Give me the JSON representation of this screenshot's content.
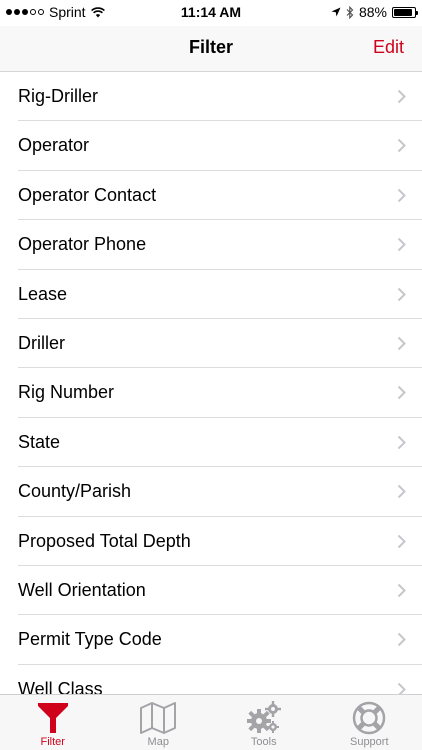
{
  "status_bar": {
    "carrier": "Sprint",
    "time": "11:14 AM",
    "battery": "88%",
    "battery_level": 0.88,
    "icons": [
      "signal-dots",
      "wifi-icon",
      "location-arrow-icon",
      "bluetooth-icon",
      "battery-icon"
    ]
  },
  "nav": {
    "title": "Filter",
    "edit_label": "Edit"
  },
  "colors": {
    "accent": "#d0021b",
    "inactive": "#8e8e93",
    "separator": "#dcdcdf"
  },
  "list": {
    "items": [
      {
        "label": "Rig-Driller"
      },
      {
        "label": "Operator"
      },
      {
        "label": "Operator Contact"
      },
      {
        "label": "Operator Phone"
      },
      {
        "label": "Lease"
      },
      {
        "label": "Driller"
      },
      {
        "label": "Rig Number"
      },
      {
        "label": "State"
      },
      {
        "label": "County/Parish"
      },
      {
        "label": "Proposed Total Depth"
      },
      {
        "label": "Well Orientation"
      },
      {
        "label": "Permit Type Code"
      },
      {
        "label": "Well Class"
      }
    ]
  },
  "tab_bar": {
    "tabs": [
      {
        "label": "Filter",
        "icon": "filter-funnel-icon",
        "active": true
      },
      {
        "label": "Map",
        "icon": "map-icon",
        "active": false
      },
      {
        "label": "Tools",
        "icon": "gears-icon",
        "active": false
      },
      {
        "label": "Support",
        "icon": "lifebuoy-icon",
        "active": false
      }
    ]
  }
}
